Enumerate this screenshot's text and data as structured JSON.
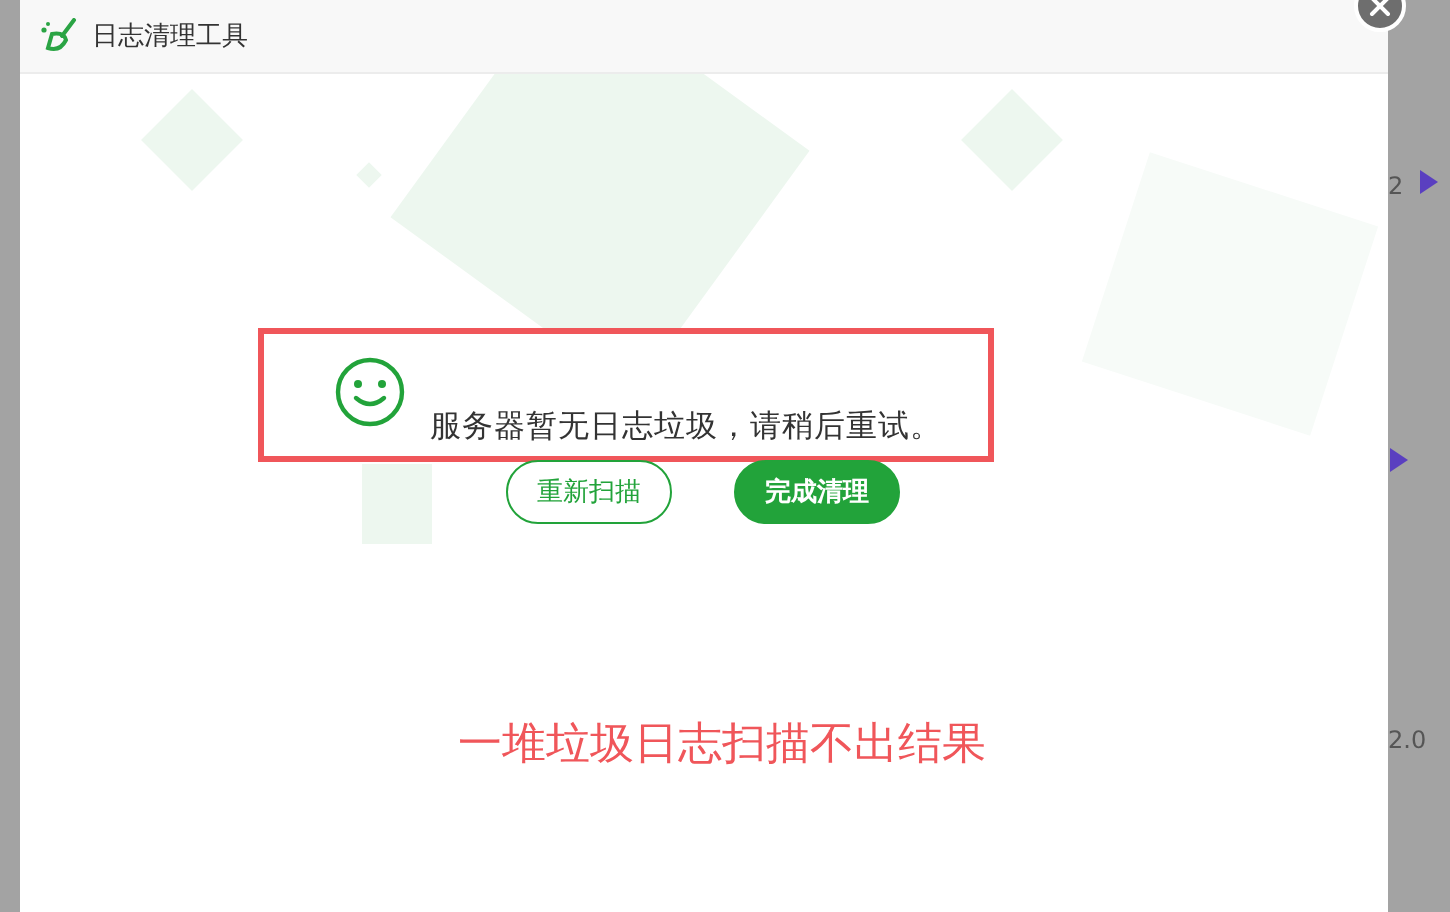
{
  "window": {
    "title": "日志清理工具"
  },
  "message": "服务器暂无日志垃圾，请稍后重试。",
  "buttons": [
    {
      "label": "重新扫描",
      "kind": "outline"
    },
    {
      "label": "完成清理",
      "kind": "filled"
    }
  ],
  "annotation": "一堆垃圾日志扫描不出结果",
  "background_labels": [
    "2",
    "2.0"
  ]
}
